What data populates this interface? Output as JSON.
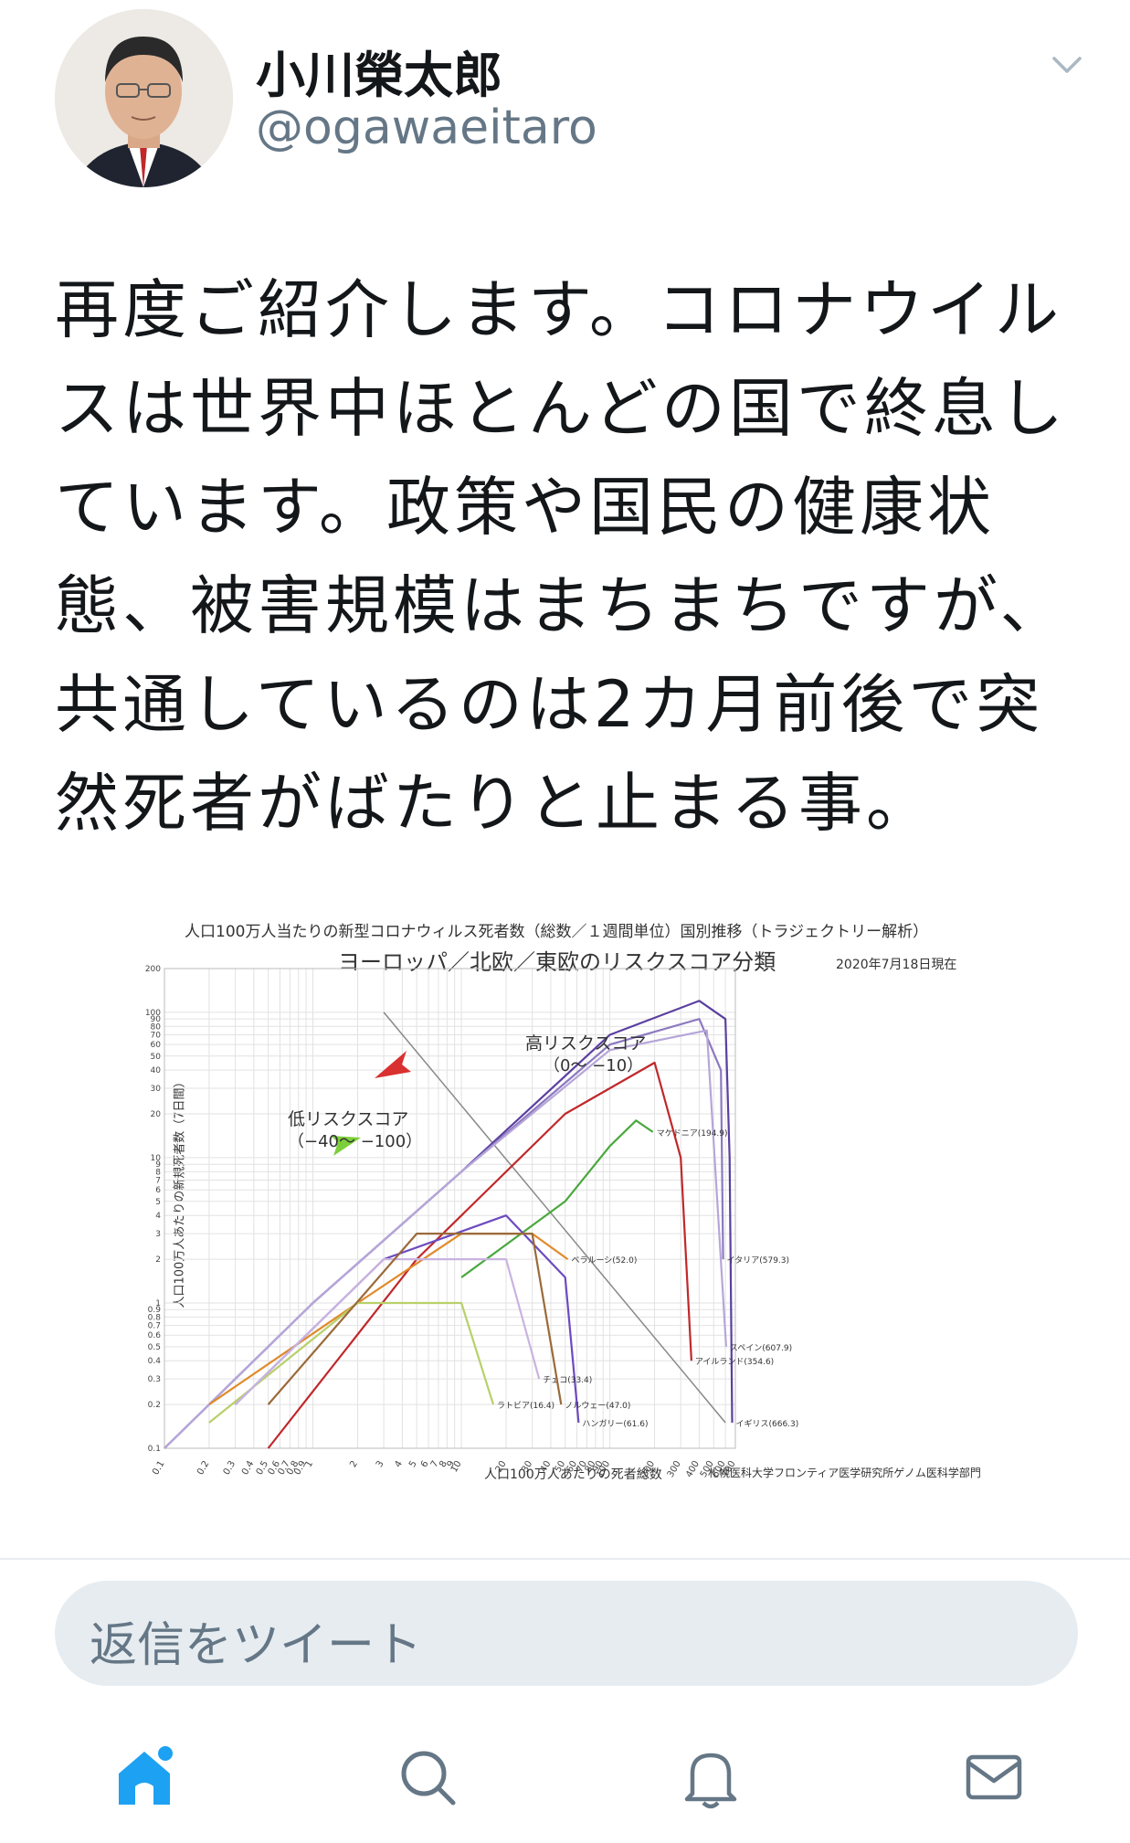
{
  "user": {
    "display_name": "小川榮太郎",
    "handle": "@ogawaeitaro"
  },
  "tweet": {
    "text": "再度ご紹介します。コロナウイルスは世界中ほとんどの国で終息しています。政策や国民の健康状態、被害規模はまちまちですが、共通しているのは2カ月前後で突然死者がばたりと止まる事。"
  },
  "chart_data": {
    "type": "line",
    "title": "人口100万人当たりの新型コロナウィルス死者数（総数／１週間単位）国別推移（トラジェクトリー解析）",
    "subtitle": "ヨーロッパ／北欧／東欧のリスクスコア分類",
    "date": "2020年7月18日現在",
    "xlabel": "人口100万人あたりの死者総数",
    "ylabel": "人口100万人あたりの新規死者数（7日間）",
    "credit": "札幌医科大学フロンティア医学研究所ゲノム医科学部門",
    "xscale": "log",
    "yscale": "log",
    "xlim": [
      0.1,
      700
    ],
    "ylim": [
      0.1,
      200
    ],
    "x_ticks": [
      "0.1",
      "0.2",
      "0.3",
      "0.4",
      "0.5",
      "0.6",
      "0.7",
      "0.8",
      "0.9",
      "1",
      "2",
      "3",
      "4",
      "5",
      "6",
      "7",
      "8",
      "9",
      "10",
      "20",
      "30",
      "40",
      "50",
      "60",
      "70",
      "80",
      "90",
      "100",
      "200",
      "300",
      "400",
      "500",
      "600",
      "700"
    ],
    "y_ticks": [
      "0.1",
      "0.2",
      "0.3",
      "0.4",
      "0.5",
      "0.6",
      "0.7",
      "0.8",
      "0.9",
      "1",
      "2",
      "3",
      "4",
      "5",
      "6",
      "7",
      "8",
      "9",
      "10",
      "20",
      "30",
      "40",
      "50",
      "60",
      "70",
      "80",
      "90",
      "100",
      "200"
    ],
    "annotations": {
      "high_risk": "高リスクスコア",
      "high_risk_range": "（0〜 −10）",
      "low_risk": "低リスクスコア",
      "low_risk_range": "（−40〜 −100）"
    },
    "series": [
      {
        "name": "イギリス(666.3)",
        "color": "#5b3fa0",
        "x": [
          0.1,
          1,
          10,
          100,
          400,
          600,
          640,
          666
        ],
        "y": [
          0.1,
          1,
          8,
          70,
          120,
          90,
          10,
          0.15
        ]
      },
      {
        "name": "イタリア(579.3)",
        "color": "#8c79c0",
        "x": [
          0.1,
          1,
          10,
          100,
          400,
          560,
          579
        ],
        "y": [
          0.1,
          1,
          8,
          60,
          90,
          40,
          2
        ]
      },
      {
        "name": "スペイン(607.9)",
        "color": "#b6a6d8",
        "x": [
          0.1,
          1,
          10,
          100,
          450,
          607
        ],
        "y": [
          0.1,
          1,
          8,
          55,
          75,
          0.5
        ]
      },
      {
        "name": "アイルランド(354.6)",
        "color": "#c0282a",
        "x": [
          0.5,
          5,
          50,
          200,
          300,
          354
        ],
        "y": [
          0.1,
          2,
          20,
          45,
          10,
          0.4
        ]
      },
      {
        "name": "マケドニア(194.9)",
        "color": "#4aa83e",
        "x": [
          10,
          50,
          100,
          150,
          194.9
        ],
        "y": [
          1.5,
          5,
          12,
          18,
          15
        ]
      },
      {
        "name": "ベラルーシ(52.0)",
        "color": "#e08a2a",
        "x": [
          0.2,
          2,
          10,
          30,
          52
        ],
        "y": [
          0.2,
          1,
          3,
          3,
          2
        ]
      },
      {
        "name": "ハンガリー(61.6)",
        "color": "#6c4ac0",
        "x": [
          0.3,
          3,
          20,
          50,
          61.6
        ],
        "y": [
          0.2,
          2,
          4,
          1.5,
          0.15
        ]
      },
      {
        "name": "ラトビア(16.4)",
        "color": "#b8d06a",
        "x": [
          0.2,
          2,
          10,
          16.4
        ],
        "y": [
          0.15,
          1,
          1,
          0.2
        ]
      },
      {
        "name": "チェコ(33.4)",
        "color": "#c9b3e0",
        "x": [
          0.3,
          3,
          20,
          33.4
        ],
        "y": [
          0.2,
          2,
          2,
          0.3
        ]
      },
      {
        "name": "ノルウェー(47.0)",
        "color": "#9a6a3a",
        "x": [
          0.5,
          5,
          30,
          47
        ],
        "y": [
          0.2,
          3,
          3,
          0.2
        ]
      }
    ]
  },
  "reply": {
    "placeholder": "返信をツイート"
  },
  "tabs": [
    {
      "icon": "home-icon",
      "active": true
    },
    {
      "icon": "search-icon",
      "active": false
    },
    {
      "icon": "notifications-icon",
      "active": false
    },
    {
      "icon": "messages-icon",
      "active": false
    }
  ],
  "colors": {
    "accent": "#1da1f2",
    "secondary_text": "#657786"
  }
}
